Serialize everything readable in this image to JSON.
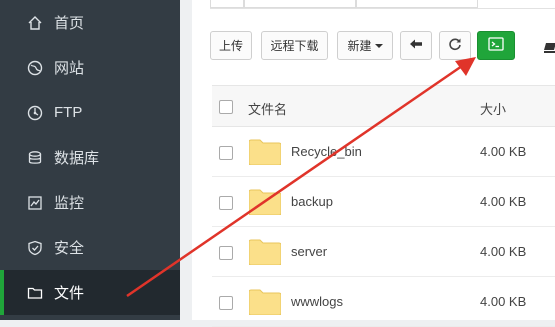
{
  "sidebar": {
    "items": [
      {
        "label": "首页",
        "icon": "home-icon"
      },
      {
        "label": "网站",
        "icon": "globe-icon"
      },
      {
        "label": "FTP",
        "icon": "ftp-icon"
      },
      {
        "label": "数据库",
        "icon": "database-icon"
      },
      {
        "label": "监控",
        "icon": "monitor-icon"
      },
      {
        "label": "安全",
        "icon": "shield-icon"
      },
      {
        "label": "文件",
        "icon": "folder-icon"
      }
    ],
    "active": "文件"
  },
  "toolbar": {
    "upload_label": "上传",
    "remote_download_label": "远程下载",
    "new_label": "新建",
    "back_icon": "arrow-left-icon",
    "refresh_icon": "refresh-icon",
    "terminal_icon": "terminal-icon"
  },
  "table": {
    "headers": {
      "name": "文件名",
      "size": "大小"
    },
    "rows": [
      {
        "name": "Recycle_bin",
        "size": "4.00 KB"
      },
      {
        "name": "backup",
        "size": "4.00 KB"
      },
      {
        "name": "server",
        "size": "4.00 KB"
      },
      {
        "name": "wwwlogs",
        "size": "4.00 KB"
      }
    ]
  },
  "colors": {
    "sidebar_bg": "#333c44",
    "accent_green": "#20a53a",
    "annotation_red": "#e0342a",
    "folder_yellow": "#fbe08a"
  }
}
